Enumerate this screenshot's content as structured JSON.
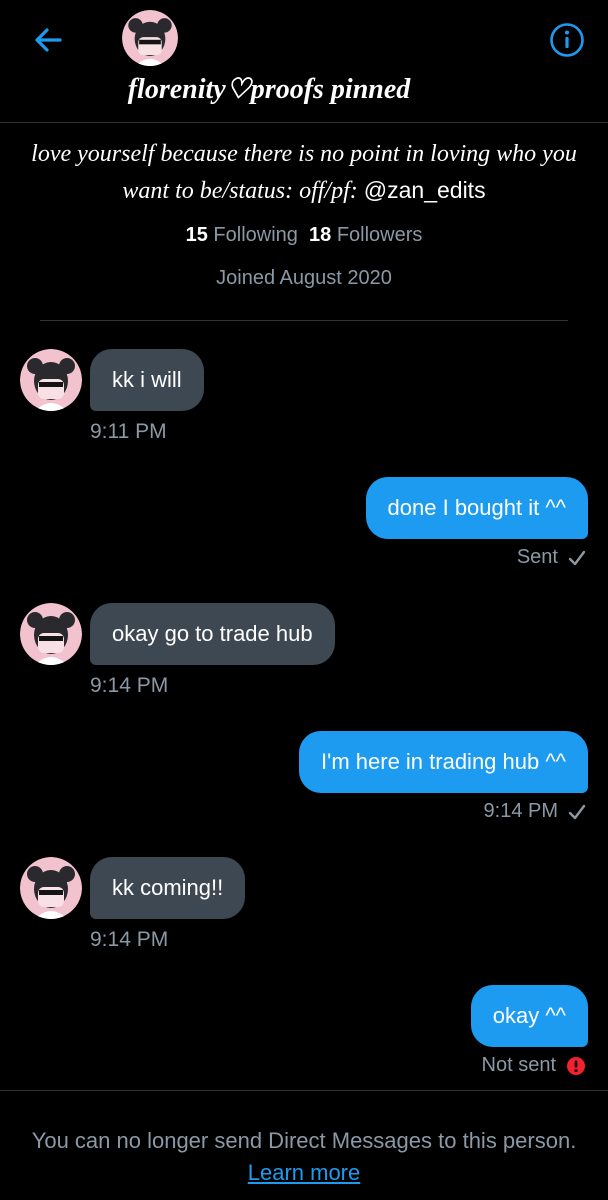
{
  "header": {
    "back_icon": "arrow-left-icon",
    "info_icon": "info-circle-icon",
    "name": "florenity♡proofs pinned",
    "accent_color": "#1d9bf0"
  },
  "profile": {
    "bio_text": "love yourself because there is no point in loving who you want to be/status: off/pf:",
    "bio_handle": "@zan_edits",
    "following_count": "15",
    "following_label": "Following",
    "followers_count": "18",
    "followers_label": "Followers",
    "joined": "Joined August 2020"
  },
  "messages": [
    {
      "direction": "in",
      "text": "kk i will",
      "time": "9:11 PM"
    },
    {
      "direction": "out",
      "text": "done I bought it ^^",
      "status": "Sent",
      "status_icon": "check-icon"
    },
    {
      "direction": "in",
      "text": "okay go to trade hub",
      "time": "9:14 PM"
    },
    {
      "direction": "out",
      "text": "I'm here in trading hub ^^",
      "status": "9:14 PM",
      "status_icon": "check-icon"
    },
    {
      "direction": "in",
      "text": "kk coming!!",
      "time": "9:14 PM"
    },
    {
      "direction": "out",
      "text": "okay ^^",
      "status": "Not sent",
      "status_icon": "error-icon"
    }
  ],
  "footer": {
    "notice_text": "You can no longer send Direct Messages to this person.",
    "learn_more": "Learn more"
  },
  "colors": {
    "background": "#000000",
    "incoming_bubble": "#3d4852",
    "outgoing_bubble": "#1d9bf0",
    "secondary_text": "#8b98a5",
    "error": "#f4212e"
  }
}
